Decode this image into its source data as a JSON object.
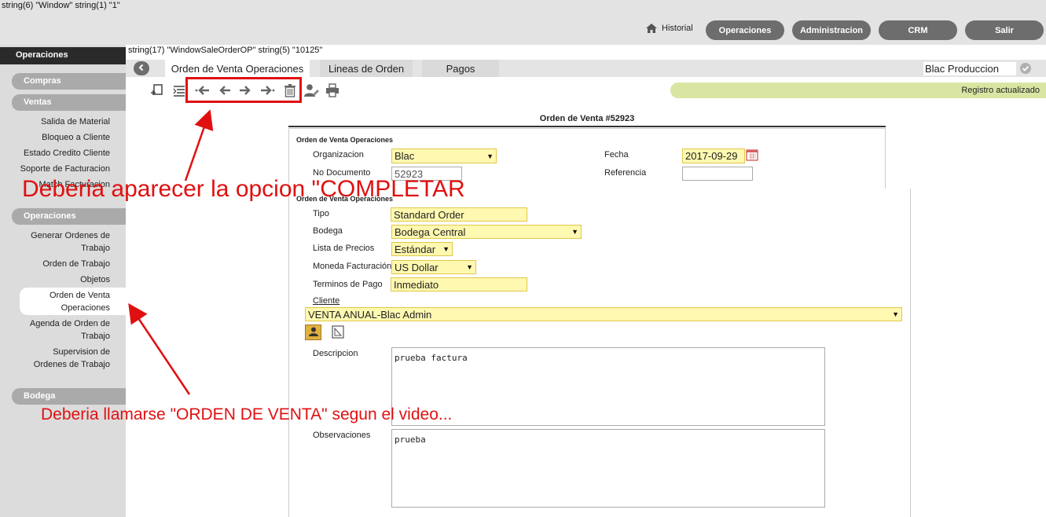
{
  "debug": {
    "line1": "string(6) \"Window\" string(1) \"1\"",
    "line2": "string(17) \"WindowSaleOrderOP\" string(5) \"10125\""
  },
  "topnav": {
    "historial": "Historial",
    "buttons": [
      "Operaciones",
      "Administracion",
      "CRM",
      "Salir"
    ]
  },
  "sidebar": {
    "active": "Operaciones",
    "sections": {
      "compras": "Compras",
      "ventas": "Ventas",
      "operaciones": "Operaciones",
      "bodega": "Bodega"
    },
    "ventas_items": [
      "Salida de Material",
      "Bloqueo a Cliente",
      "Estado Credito Cliente",
      "Soporte de Facturacion",
      "Match Facturacion"
    ],
    "operaciones_items": [
      [
        "Generar Ordenes de",
        "Trabajo"
      ],
      [
        "Orden de Trabajo"
      ],
      [
        "Objetos"
      ],
      [
        "Orden de Venta",
        "Operaciones"
      ],
      [
        "Agenda de Orden de",
        "Trabajo"
      ],
      [
        "Supervision de",
        "Ordenes de Trabajo"
      ]
    ]
  },
  "tabs": [
    "Orden de Venta Operaciones",
    "Lineas de Orden",
    "Pagos"
  ],
  "org_selector": "Blac Produccion",
  "status_message": "Registro actualizado",
  "form": {
    "title": "Orden de Venta #52923",
    "section1": "Orden de Venta Operaciones",
    "section2": "Orden de Venta Operaciones",
    "organizacion_label": "Organizacion",
    "organizacion_value": "Blac",
    "no_documento_label": "No Documento",
    "no_documento_value": "52923",
    "fecha_label": "Fecha",
    "fecha_value": "2017-09-29",
    "referencia_label": "Referencia",
    "referencia_value": "",
    "tipo_label": "Tipo",
    "tipo_value": "Standard Order",
    "bodega_label": "Bodega",
    "bodega_value": "Bodega Central",
    "lista_precios_label": "Lista de Precios",
    "lista_precios_value": "Estándar",
    "moneda_label": "Moneda Facturación",
    "moneda_value": "US Dollar",
    "terminos_label": "Terminos de Pago",
    "terminos_value": "Inmediato",
    "cliente_label": "Cliente",
    "cliente_value": "VENTA ANUAL-Blac Admin",
    "descripcion_label": "Descripcion",
    "descripcion_value": "prueba factura",
    "observaciones_label": "Observaciones",
    "observaciones_value": "prueba"
  },
  "annotations": {
    "completar": "Deberia aparecer la opcion \"COMPLETAR",
    "orden_venta": "Deberia llamarse \"ORDEN DE VENTA\" segun el video..."
  },
  "colors": {
    "annotation_red": "#e01010",
    "pill_gray": "#6d6d6d",
    "field_yellow": "#fff8b0",
    "status_green": "#d9e6a3"
  }
}
